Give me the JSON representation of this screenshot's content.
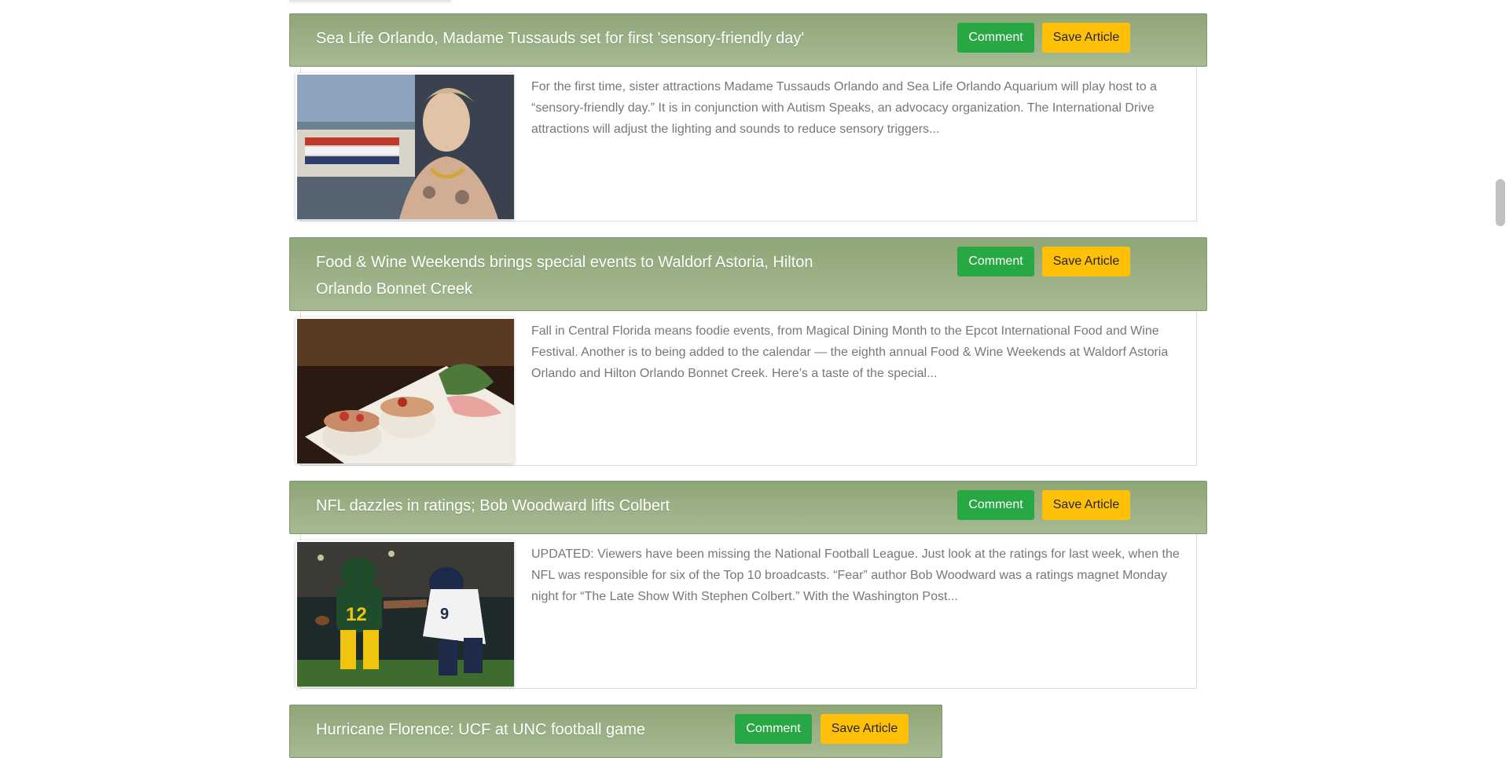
{
  "articles": [
    {
      "title": "Sea Life Orlando, Madame Tussauds set for first 'sensory-friendly day'",
      "comment_label": "Comment",
      "save_label": "Save Article",
      "summary": "For the first time, sister attractions Madame Tussauds Orlando and Sea Life Orlando Aquarium will play host to a “sensory-friendly day.” It is in conjunction with Autism Speaks, an advocacy organization. The International Drive attractions will adjust the lighting and sounds to reduce sensory triggers..."
    },
    {
      "title": "Food & Wine Weekends brings special events to Waldorf Astoria, Hilton Orlando Bonnet Creek",
      "comment_label": "Comment",
      "save_label": "Save Article",
      "summary": "Fall in Central Florida means foodie events, from Magical Dining Month to the Epcot International Food and Wine Festival. Another is to being added to the calendar — the eighth annual Food & Wine Weekends at Waldorf Astoria Orlando and Hilton Orlando Bonnet Creek. Here’s a taste of the special..."
    },
    {
      "title": "NFL dazzles in ratings; Bob Woodward lifts Colbert",
      "comment_label": "Comment",
      "save_label": "Save Article",
      "summary": "UPDATED: Viewers have been missing the National Football League. Just look at the ratings for last week, when the NFL was responsible for six of the Top 10 broadcasts. “Fear” author Bob Woodward was a ratings magnet Monday night for “The Late Show With Stephen Colbert.” With the Washington Post..."
    },
    {
      "title": "Hurricane Florence: UCF at UNC football game",
      "comment_label": "Comment",
      "save_label": "Save Article"
    }
  ],
  "colors": {
    "header_gradient_top": "#8fa678",
    "header_gradient_bottom": "#a7ba93",
    "comment_button": "#28a745",
    "save_button": "#ffc107",
    "summary_text": "#777777"
  }
}
